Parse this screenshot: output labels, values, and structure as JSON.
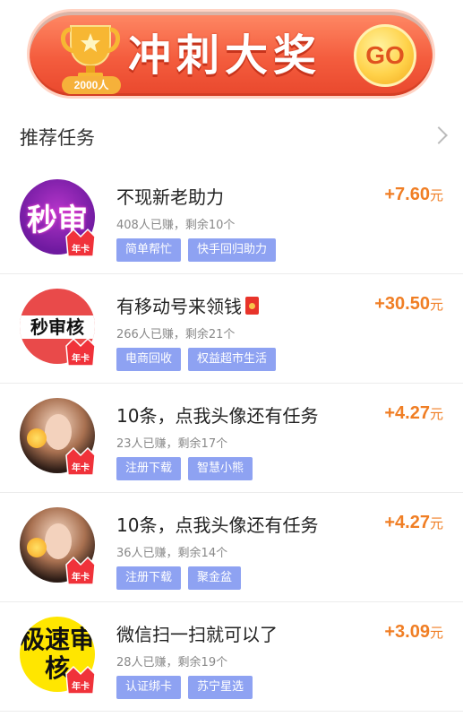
{
  "banner": {
    "title": "冲刺大奖",
    "trophy_label": "2000人",
    "go_label": "GO"
  },
  "section": {
    "title": "推荐任务"
  },
  "tasks": [
    {
      "title": "不现新老助力",
      "meta": "408人已赚，剩余10个",
      "tags": [
        "简单帮忙",
        "快手回归助力"
      ],
      "reward": "+7.60",
      "unit": "元",
      "avatar_text": "秒审",
      "badge": "年卡"
    },
    {
      "title": "有移动号来领钱",
      "meta": "266人已赚，剩余21个",
      "tags": [
        "电商回收",
        "权益超市生活"
      ],
      "reward": "+30.50",
      "unit": "元",
      "avatar_text": "秒审核",
      "badge": "年卡"
    },
    {
      "title": "10条，点我头像还有任务",
      "meta": "23人已赚，剩余17个",
      "tags": [
        "注册下载",
        "智慧小熊"
      ],
      "reward": "+4.27",
      "unit": "元",
      "badge": "年卡"
    },
    {
      "title": "10条，点我头像还有任务",
      "meta": "36人已赚，剩余14个",
      "tags": [
        "注册下载",
        "聚金盆"
      ],
      "reward": "+4.27",
      "unit": "元",
      "badge": "年卡"
    },
    {
      "title": "微信扫一扫就可以了",
      "meta": "28人已赚，剩余19个",
      "tags": [
        "认证绑卡",
        "苏宁星选"
      ],
      "reward": "+3.09",
      "unit": "元",
      "avatar_text": "极速审核",
      "badge": "年卡"
    }
  ],
  "colors": {
    "reward": "#f07e24",
    "tag": "#8ea2f2",
    "banner": "#f45d3e"
  }
}
